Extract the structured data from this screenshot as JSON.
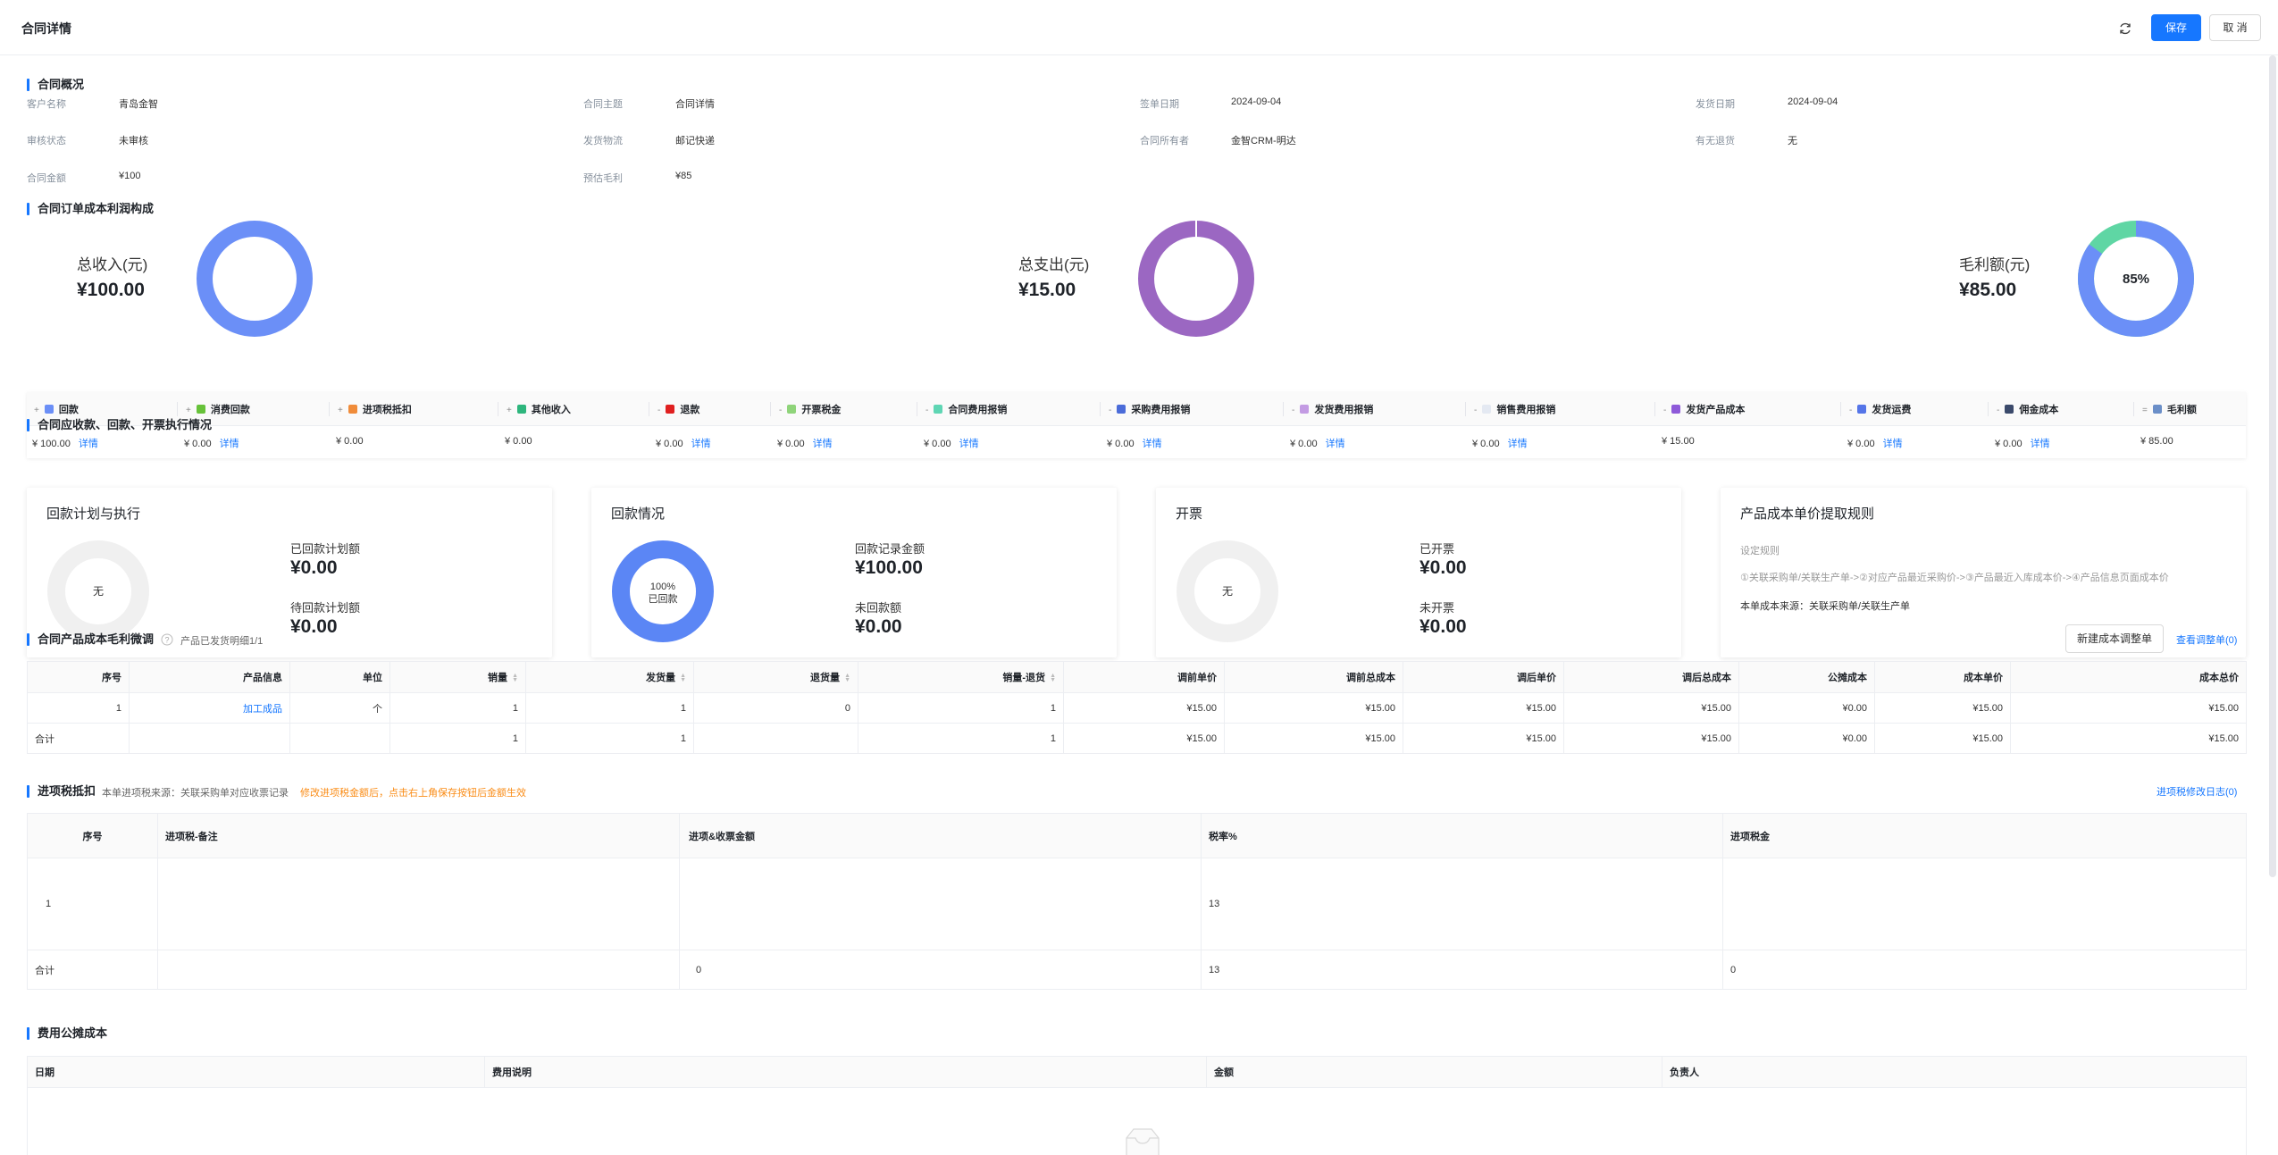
{
  "header": {
    "title": "合同详情",
    "save_label": "保存",
    "cancel_label": "取 消"
  },
  "overview": {
    "title": "合同概况",
    "fields": [
      {
        "label": "客户名称",
        "value": "青岛金智"
      },
      {
        "label": "合同主题",
        "value": "合同详情"
      },
      {
        "label": "签单日期",
        "value": "2024-09-04"
      },
      {
        "label": "发货日期",
        "value": "2024-09-04"
      },
      {
        "label": "审核状态",
        "value": "未审核"
      },
      {
        "label": "发货物流",
        "value": "邮记快递"
      },
      {
        "label": "合同所有者",
        "value": "金智CRM-明达"
      },
      {
        "label": "有无退货",
        "value": "无"
      },
      {
        "label": "合同金额",
        "value": "¥100"
      },
      {
        "label": "预估毛利",
        "value": "¥85"
      }
    ]
  },
  "profit": {
    "title": "合同订单成本利润构成",
    "summaries": [
      {
        "label": "总收入(元)",
        "value": "¥100.00",
        "color": "#6b8ff7"
      },
      {
        "label": "总支出(元)",
        "value": "¥15.00",
        "color": "#9b67c2"
      },
      {
        "label": "毛利额(元)",
        "value": "¥85.00",
        "center": "85%",
        "color": "#6b8ff7",
        "accent": "#5fd6a4",
        "percent": 85
      }
    ],
    "items": [
      {
        "op": "+",
        "name": "回款",
        "color": "#6b8ff7",
        "value": "¥ 100.00",
        "detail": "详情"
      },
      {
        "op": "+",
        "name": "消费回款",
        "color": "#67c23a",
        "value": "¥ 0.00",
        "detail": "详情"
      },
      {
        "op": "+",
        "name": "进项税抵扣",
        "color": "#f08c3a",
        "value": "¥ 0.00",
        "detail": ""
      },
      {
        "op": "+",
        "name": "其他收入",
        "color": "#2eb67d",
        "value": "¥ 0.00",
        "detail": ""
      },
      {
        "op": "-",
        "name": "退款",
        "color": "#e02020",
        "value": "¥ 0.00",
        "detail": "详情"
      },
      {
        "op": "-",
        "name": "开票税金",
        "color": "#8fd47a",
        "value": "¥ 0.00",
        "detail": "详情"
      },
      {
        "op": "-",
        "name": "合同费用报销",
        "color": "#5fd6b4",
        "value": "¥ 0.00",
        "detail": "详情"
      },
      {
        "op": "-",
        "name": "采购费用报销",
        "color": "#4b6cd9",
        "value": "¥ 0.00",
        "detail": "详情"
      },
      {
        "op": "-",
        "name": "发货费用报销",
        "color": "#c39be3",
        "value": "¥ 0.00",
        "detail": "详情"
      },
      {
        "op": "-",
        "name": "销售费用报销",
        "color": "#e4e9f2",
        "value": "¥ 0.00",
        "detail": "详情"
      },
      {
        "op": "-",
        "name": "发货产品成本",
        "color": "#8e5ad9",
        "value": "¥ 15.00",
        "detail": ""
      },
      {
        "op": "-",
        "name": "发货运费",
        "color": "#5575e8",
        "value": "¥ 0.00",
        "detail": "详情"
      },
      {
        "op": "-",
        "name": "佣金成本",
        "color": "#3b4a6b",
        "value": "¥ 0.00",
        "detail": "详情"
      },
      {
        "op": "=",
        "name": "毛利额",
        "color": "#6b8fc8",
        "value": "¥ 85.00",
        "detail": ""
      }
    ]
  },
  "execution": {
    "title": "合同应收款、回款、开票执行情况",
    "cards": [
      {
        "title": "回款计划与执行",
        "donut_text": "无",
        "donut_text2": "",
        "m1_label": "已回款计划额",
        "m1_value": "¥0.00",
        "m2_label": "待回款计划额",
        "m2_value": "¥0.00"
      },
      {
        "title": "回款情况",
        "donut_text": "100%",
        "donut_text2": "已回款",
        "percent": 100,
        "m1_label": "回款记录金额",
        "m1_value": "¥100.00",
        "m2_label": "未回款额",
        "m2_value": "¥0.00"
      },
      {
        "title": "开票",
        "donut_text": "无",
        "donut_text2": "",
        "m1_label": "已开票",
        "m1_value": "¥0.00",
        "m2_label": "未开票",
        "m2_value": "¥0.00"
      }
    ],
    "rule_card": {
      "title": "产品成本单价提取规则",
      "label": "设定规则",
      "rule": "①关联采购单/关联生产单->②对应产品最近采购价->③产品最近入库成本价->④产品信息页面成本价",
      "source": "本单成本来源：关联采购单/关联生产单"
    }
  },
  "product_cost": {
    "title": "合同产品成本毛利微调",
    "subtitle": "产品已发货明细1/1",
    "new_button": "新建成本调整单",
    "view_link": "查看调整单(0)",
    "columns": [
      "序号",
      "产品信息",
      "单位",
      "销量",
      "发货量",
      "退货量",
      "销量-退货",
      "调前单价",
      "调前总成本",
      "调后单价",
      "调后总成本",
      "公摊成本",
      "成本单价",
      "成本总价"
    ],
    "rows": [
      [
        "1",
        "加工成品",
        "个",
        "1",
        "1",
        "0",
        "1",
        "¥15.00",
        "¥15.00",
        "¥15.00",
        "¥15.00",
        "¥0.00",
        "¥15.00",
        "¥15.00"
      ]
    ],
    "total": [
      "合计",
      "",
      "",
      "1",
      "1",
      "",
      "1",
      "¥15.00",
      "¥15.00",
      "¥15.00",
      "¥15.00",
      "¥0.00",
      "¥15.00",
      "¥15.00"
    ]
  },
  "input_tax": {
    "title": "进项税抵扣",
    "source_text": "本单进项税来源：关联采购单对应收票记录",
    "warning": "修改进项税金额后，点击右上角保存按钮后金额生效",
    "log_link": "进项税修改日志(0)",
    "columns": [
      "序号",
      "进项税-备注",
      "进项&收票金额",
      "税率%",
      "进项税金"
    ],
    "rows": [
      [
        "1",
        "",
        "",
        "13",
        ""
      ]
    ],
    "total": [
      "合计",
      "",
      "0",
      "13",
      "0"
    ]
  },
  "expense": {
    "title": "费用公摊成本",
    "columns": [
      "日期",
      "费用说明",
      "金额",
      "负责人"
    ]
  }
}
